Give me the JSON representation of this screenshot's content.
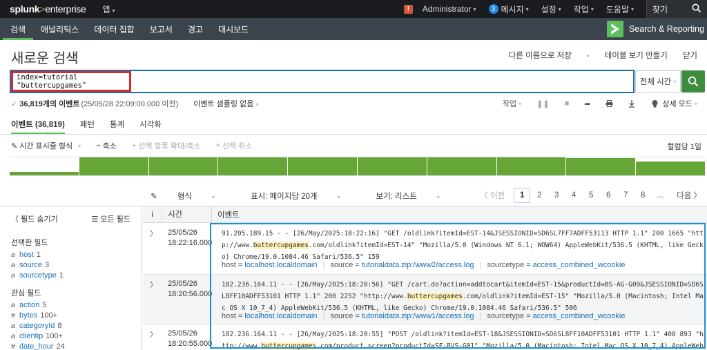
{
  "topbar": {
    "logo_main": "splunk",
    "logo_gt": ">",
    "logo_suffix": "enterprise",
    "app_menu": "앱",
    "alert_mark": "!",
    "user": "Administrator",
    "message_count": "3",
    "messages": "메시지",
    "settings": "설정",
    "activity": "작업",
    "help": "도움말",
    "find": "찾기"
  },
  "nav": {
    "items": [
      "검색",
      "애널리틱스",
      "데이터 집합",
      "보고서",
      "경고",
      "대시보드"
    ],
    "app_name": "Search & Reporting"
  },
  "page": {
    "title": "새로운 검색",
    "save_as": "다른 이름으로 저장",
    "create_table": "테이블 보기 만들기",
    "close": "닫기"
  },
  "search": {
    "query": "index=tutorial \"buttercupgames\"",
    "time_range": "전체 시간"
  },
  "status": {
    "check": "✓",
    "event_count": "36,819개의 이벤트",
    "when": "(25/05/28 22:09:00.000 이전)",
    "sampling": "이벤트 샘플링 없음",
    "job": "작업",
    "mode": "상세 모드"
  },
  "tabs": [
    "이벤트 (36,819)",
    "패턴",
    "통계",
    "시각화"
  ],
  "timeline": {
    "format": "시간 표시줄 형식",
    "zoom_out": "축소",
    "zoom_selection": "선택 항목 확대/축소",
    "deselect": "선택 취소",
    "per_column": "컬럼당 1일",
    "levels": [
      0.18,
      1,
      1,
      1,
      1,
      1,
      1,
      1,
      0.95,
      0.78
    ]
  },
  "results_toolbar": {
    "format": "형식",
    "show": "표시: 페이지당 20개",
    "view": "보기: 리스트"
  },
  "pager": {
    "prev": "〈 이전",
    "pages": [
      "1",
      "2",
      "3",
      "4",
      "5",
      "6",
      "7",
      "8"
    ],
    "ellipsis": "...",
    "next": "다음 〉"
  },
  "sidebar": {
    "hide_fields": "필드 숨기기",
    "all_fields": "모든 필드",
    "selected_title": "선택한 필드",
    "selected": [
      {
        "type": "a",
        "name": "host",
        "count": "1"
      },
      {
        "type": "a",
        "name": "source",
        "count": "3"
      },
      {
        "type": "a",
        "name": "sourcetype",
        "count": "1"
      }
    ],
    "interesting_title": "관심 필드",
    "interesting": [
      {
        "type": "a",
        "name": "action",
        "count": "5"
      },
      {
        "type": "#",
        "name": "bytes",
        "count": "100+"
      },
      {
        "type": "a",
        "name": "categoryId",
        "count": "8"
      },
      {
        "type": "a",
        "name": "clientip",
        "count": "100+"
      },
      {
        "type": "#",
        "name": "date_hour",
        "count": "24"
      }
    ]
  },
  "table": {
    "col_info": "i",
    "col_time": "시간",
    "col_event": "이벤트"
  },
  "events": [
    {
      "date": "25/05/26",
      "time": "18:22:16.000",
      "raw_parts": [
        "91.205.189.15 - - [26/May/2025:18:22:16] \"GET /oldlink?itemId=EST-14&JSESSIONID=SD6SL7FF7ADFF53113 HTTP 1.1\" 200 1665 \"http://www.",
        "buttercupgames",
        ".com/oldlink?itemId=EST-14\" \"Mozilla/5.0 (Windows NT 6.1; WOW64) AppleWebKit/536.5 (KHTML, like Gecko) Chrome/19.0.1084.46 Safari/536.5\" 159"
      ],
      "host": "localhost.localdomain",
      "source": "tutorialdata.zip:/www2/access.log",
      "sourcetype": "access_combined_wcookie"
    },
    {
      "date": "25/05/26",
      "time": "18:20:56.000",
      "raw_parts": [
        "182.236.164.11 - - [26/May/2025:18:20:56] \"GET /cart.do?action=addtocart&itemId=EST-15&productId=BS-AG-G09&JSESSIONID=SD6SL8FF10ADFF53101 HTTP 1.1\" 200 2252 \"http://www.",
        "buttercupgames",
        ".com/oldlink?itemId=EST-15\" \"Mozilla/5.0 (Macintosh; Intel Mac OS X 10_7_4) AppleWebKit/536.5 (KHTML, like Gecko) Chrome/19.0.1084.46 Safari/536.5\" 506"
      ],
      "host": "localhost.localdomain",
      "source": "tutorialdata.zip:/www1/access.log",
      "sourcetype": "access_combined_wcookie"
    },
    {
      "date": "25/05/26",
      "time": "18:20:55.000",
      "raw_parts": [
        "182.236.164.11 - - [26/May/2025:18:20:55] \"POST /oldlink?itemId=EST-18&JSESSIONID=SD6SL8FF10ADFF53101 HTTP 1.1\" 408 893 \"http://www.",
        "buttercupgames",
        ".com/product.screen?productId=SF-BVS-G01\" \"Mozilla/5.0 (Macintosh; Intel Mac OS X 10_7_4) AppleWebKit/536.5 (KHTML, like Geck"
      ],
      "host": "",
      "source": "",
      "sourcetype": ""
    }
  ],
  "meta_labels": {
    "host": "host =",
    "source": "source =",
    "sourcetype": "sourcetype ="
  },
  "colors": {
    "accent_green": "#5cc05c",
    "highlight_red": "#d62929",
    "highlight_blue": "#1a8fd1"
  }
}
